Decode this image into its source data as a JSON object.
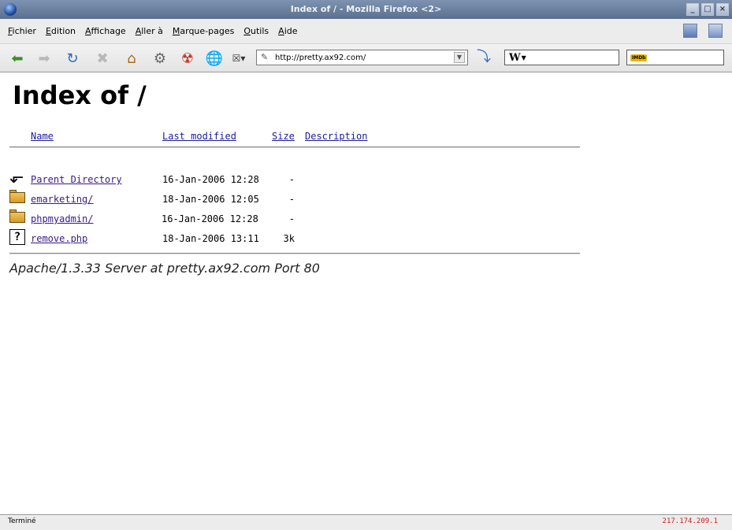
{
  "window": {
    "title": "Index of / - Mozilla Firefox <2>",
    "buttons": [
      "_",
      "□",
      "×"
    ]
  },
  "menu": [
    "Fichier",
    "Edition",
    "Affichage",
    "Aller à",
    "Marque-pages",
    "Outils",
    "Aide"
  ],
  "toolbar": {
    "url": "http://pretty.ax92.com/",
    "search_engine": "W",
    "search_value": "",
    "imdb_label": "IMDb",
    "imdb_value": ""
  },
  "page": {
    "title": "Index of /",
    "columns": {
      "name": "Name",
      "modified": "Last modified",
      "size": "Size",
      "description": "Description"
    },
    "rows": [
      {
        "icon": "back-arrow-icon",
        "name": "Parent Directory",
        "modified": "16-Jan-2006 12:28",
        "size": "-"
      },
      {
        "icon": "folder-icon",
        "name": "emarketing/",
        "modified": "18-Jan-2006 12:05",
        "size": "-"
      },
      {
        "icon": "folder-icon",
        "name": "phpmyadmin/",
        "modified": "16-Jan-2006 12:28",
        "size": "-"
      },
      {
        "icon": "unknown-file-icon",
        "name": "remove.php",
        "modified": "18-Jan-2006 13:11",
        "size": "3k"
      }
    ],
    "footer": "Apache/1.3.33 Server at pretty.ax92.com Port 80"
  },
  "status": {
    "text": "Terminé",
    "ip": "217.174.209.1"
  },
  "colors": {
    "titlebar": "#6c80a0",
    "link": "#1b1ba0",
    "visited_link": "#3a1a86",
    "ip_text": "#d11b1b"
  }
}
